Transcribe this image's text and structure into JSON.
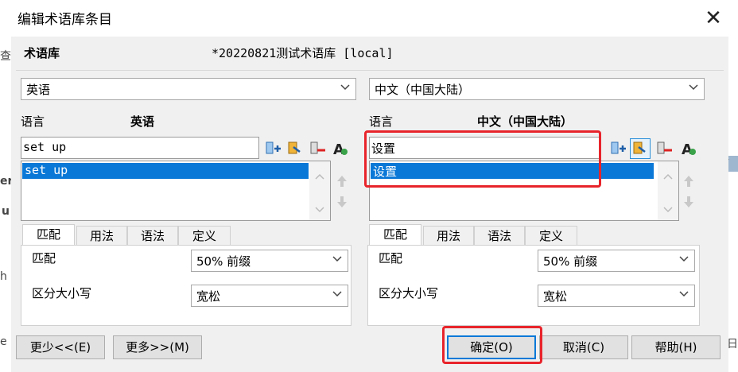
{
  "window": {
    "title": "编辑术语库条目"
  },
  "termbase": {
    "label": "术语库",
    "name": "*20220821测试术语库 [local]"
  },
  "left": {
    "language_select": "英语",
    "language_label": "语言",
    "language_value": "英语",
    "term_value": "set up",
    "list_items": [
      "set up"
    ],
    "tabs": [
      "匹配",
      "用法",
      "语法",
      "定义"
    ],
    "match_label": "匹配",
    "match_value": "50% 前缀",
    "case_label": "区分大小写",
    "case_value": "宽松"
  },
  "right": {
    "language_select": "中文（中国大陆）",
    "language_label": "语言",
    "language_value": "中文（中国大陆）",
    "term_value": "设置",
    "list_items": [
      "设置"
    ],
    "tabs": [
      "匹配",
      "用法",
      "语法",
      "定义"
    ],
    "match_label": "匹配",
    "match_value": "50% 前缀",
    "case_label": "区分大小写",
    "case_value": "宽松"
  },
  "buttons": {
    "less": "更少<<(E)",
    "more": "更多>>(M)",
    "ok": "确定(O)",
    "cancel": "取消(C)",
    "help": "帮助(H)"
  },
  "background_fragments": [
    "查",
    "er",
    "u",
    "h",
    "e",
    "or",
    "日"
  ],
  "colors": {
    "selection": "#0a78d7",
    "highlight_box": "#e8242b",
    "default_button_border": "#0078d7"
  }
}
